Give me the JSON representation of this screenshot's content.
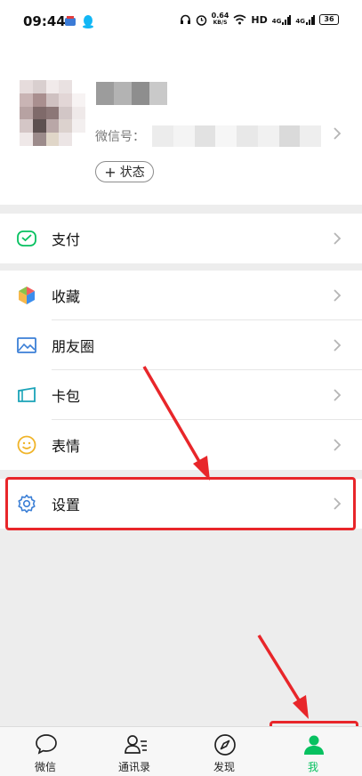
{
  "status_bar": {
    "time": "09:44",
    "net_speed_value": "0.64",
    "net_speed_unit": "KB/S",
    "hd_label": "HD",
    "signal1_label": "4G",
    "signal2_label": "4G",
    "battery": "36"
  },
  "profile": {
    "wechat_id_label": "微信号：",
    "status_button_label": "状态",
    "status_button_plus": "+"
  },
  "menu_groups": [
    {
      "items": [
        {
          "label": "支付",
          "icon": "wechat-pay-icon"
        }
      ]
    },
    {
      "items": [
        {
          "label": "收藏",
          "icon": "favorites-cube-icon"
        },
        {
          "label": "朋友圈",
          "icon": "moments-picture-icon"
        },
        {
          "label": "卡包",
          "icon": "card-wallet-icon"
        },
        {
          "label": "表情",
          "icon": "sticker-smile-icon"
        }
      ]
    },
    {
      "items": [
        {
          "label": "设置",
          "icon": "gear-icon"
        }
      ]
    }
  ],
  "bottom_nav": {
    "items": [
      {
        "label": "微信",
        "icon": "chat-bubble-icon",
        "active": false
      },
      {
        "label": "通讯录",
        "icon": "contacts-icon",
        "active": false
      },
      {
        "label": "发现",
        "icon": "compass-icon",
        "active": false
      },
      {
        "label": "我",
        "icon": "me-person-icon",
        "active": true
      }
    ]
  },
  "colors": {
    "accent_green": "#07c160",
    "annotation_red": "#e8262a",
    "background_gray": "#ededed"
  }
}
